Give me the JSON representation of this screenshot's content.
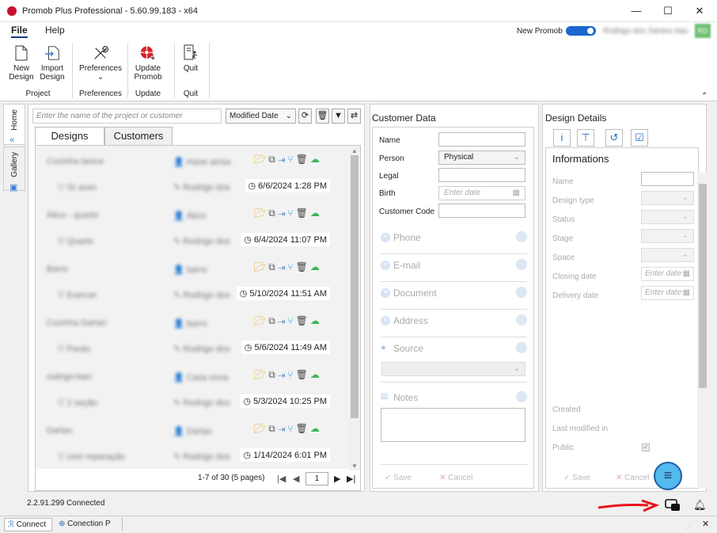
{
  "window": {
    "title": "Promob Plus Professional - 5.60.99.183 - x64",
    "minimize": "—",
    "maximize": "☐",
    "close": "✕"
  },
  "menu": {
    "file": "File",
    "help": "Help",
    "new_promob_label": "New Promob",
    "user_name": "Rodrigo dos Santos Itaú",
    "user_initials": "RD"
  },
  "ribbon": {
    "new_design": "New Design",
    "import_design": "Import Design",
    "group_project": "Project",
    "preferences": "Preferences",
    "group_preferences": "Preferences",
    "update_promob": "Update Promob",
    "group_update": "Update",
    "quit": "Quit",
    "group_quit": "Quit"
  },
  "sidetabs": {
    "home": "Home",
    "gallery": "Gallery"
  },
  "search": {
    "placeholder": "Enter the name of the project or customer",
    "sort": "Modified Date"
  },
  "tabs": {
    "designs": "Designs",
    "customers": "Customers"
  },
  "designs": [
    {
      "name": "Cozinha lanice",
      "owner": "Hane ainsa",
      "subtitle": "Gi aves",
      "author": "Rodrigo dos",
      "date": "6/6/2024 1:28 PM"
    },
    {
      "name": "Ático - quarto",
      "owner": "Ático",
      "subtitle": "Quarto",
      "author": "Rodrigo dos",
      "date": "6/4/2024 11:07 PM"
    },
    {
      "name": "Barro",
      "owner": "barro",
      "subtitle": "Exercer",
      "author": "Rodrigo dos",
      "date": "5/10/2024 11:51 AM"
    },
    {
      "name": "Cozinha Darlan",
      "owner": "barro",
      "subtitle": "Pardo",
      "author": "Rodrigo dos",
      "date": "5/6/2024 11:49 AM"
    },
    {
      "name": "rodrigo-barr",
      "owner": "Casa nova",
      "subtitle": "2 seção",
      "author": "Rodrigo dos",
      "date": "5/3/2024 10:25 PM"
    },
    {
      "name": "Darlan",
      "owner": "Darlan",
      "subtitle": "com reparação",
      "author": "Rodrigo dos",
      "date": "1/14/2024 6:01 PM"
    }
  ],
  "pager": {
    "summary": "1-7 of 30 (5 pages)",
    "page": "1"
  },
  "customer": {
    "title": "Customer Data",
    "name_label": "Name",
    "person_label": "Person",
    "person_value": "Physical",
    "legal_label": "Legal",
    "birth_label": "Birth",
    "birth_placeholder": "Enter date",
    "code_label": "Customer Code",
    "phone": "Phone",
    "email": "E-mail",
    "document": "Document",
    "address": "Address",
    "source": "Source",
    "notes": "Notes",
    "save": "Save",
    "cancel": "Cancel"
  },
  "design_details": {
    "title": "Design Details",
    "info_title": "Informations",
    "name_label": "Name",
    "type_label": "Design type",
    "status_label": "Status",
    "stage_label": "Stage",
    "space_label": "Space",
    "closing_label": "Closing date",
    "delivery_label": "Delivery date",
    "date_placeholder": "Enter date",
    "created_label": "Created",
    "modified_label": "Last modified in",
    "public_label": "Public",
    "save": "Save",
    "cancel": "Cancel"
  },
  "status": {
    "text": "2.2.91.299 Connected"
  },
  "taskbar": {
    "connect": "Connect",
    "connection": "Conection P",
    "close": "✕"
  },
  "colors": {
    "accent": "#1a66cc",
    "annotation_arrow": "#e8141c",
    "fab": "#54b9ec"
  }
}
